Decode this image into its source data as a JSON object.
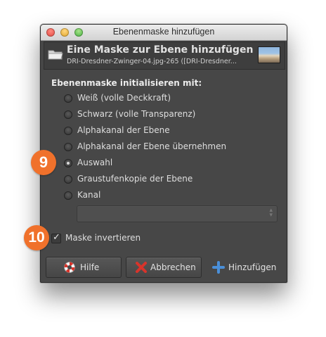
{
  "window": {
    "title": "Ebenenmaske hinzufügen"
  },
  "header": {
    "title": "Eine Maske zur Ebene hinzufügen",
    "subtitle": "DRI-Dresdner-Zwinger-04.jpg-265 ([DRI-Dresdner..."
  },
  "section_label": "Ebenenmaske initialisieren mit:",
  "options": [
    {
      "label": "Weiß (volle Deckkraft)",
      "checked": false
    },
    {
      "label": "Schwarz (volle Transparenz)",
      "checked": false
    },
    {
      "label": "Alphakanal der Ebene",
      "checked": false
    },
    {
      "label": "Alphakanal der Ebene übernehmen",
      "checked": false
    },
    {
      "label": "Auswahl",
      "checked": true
    },
    {
      "label": "Graustufenkopie der Ebene",
      "checked": false
    },
    {
      "label": "Kanal",
      "checked": false
    }
  ],
  "channel_combo": {
    "value": ""
  },
  "invert": {
    "label": "Maske invertieren",
    "checked": true
  },
  "buttons": {
    "help": "Hilfe",
    "cancel": "Abbrechen",
    "add": "Hinzufügen"
  },
  "badges": {
    "first": "9",
    "second": "10"
  },
  "icons": {
    "header": "folder-icon",
    "help": "lifebuoy-icon",
    "cancel": "red-x-icon",
    "add": "plus-icon"
  },
  "colors": {
    "dialog_bg": "#474747",
    "badge": "#f0712b",
    "add_icon": "#4a8fd8",
    "cancel_icon": "#d8342b"
  }
}
